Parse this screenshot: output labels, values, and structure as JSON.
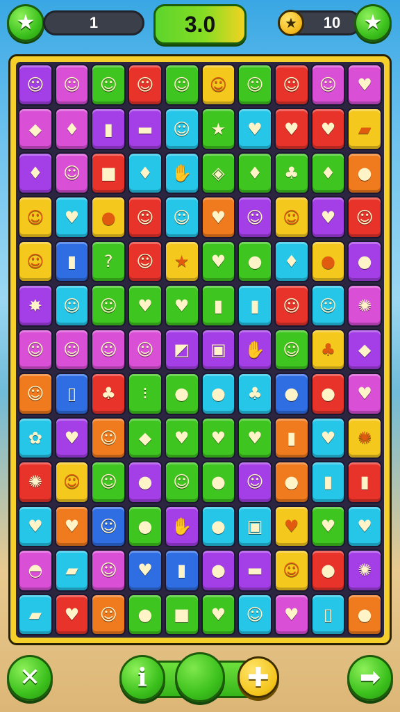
{
  "top_bar": {
    "level_value": "1",
    "score_value": "3.0",
    "coins_value": "10",
    "left_icon": "star-icon",
    "right_icon": "star-icon",
    "coin_icon": "star-coin-icon"
  },
  "bottom_bar": {
    "close_icon": "close-icon",
    "info_label": "i",
    "plus_icon": "plus-icon",
    "next_icon": "arrow-right-icon"
  },
  "colors": {
    "accent_green": "#3cc11d",
    "board_frame": "#f5d02a",
    "sky": "#39a7e4",
    "sand": "#dcb676"
  },
  "tile_palette": {
    "P": "#a43ee6",
    "O": "#f07a1e",
    "G": "#3fc51f",
    "R": "#e8332b",
    "Y": "#f5c81e",
    "C": "#25c6e8",
    "B": "#2f6de3",
    "M": "#d94fd6"
  },
  "board": {
    "rows": [
      [
        {
          "c": "P",
          "i": "☺"
        },
        {
          "c": "M",
          "i": "☺"
        },
        {
          "c": "G",
          "i": "☺"
        },
        {
          "c": "R",
          "i": "☺"
        },
        {
          "c": "G",
          "i": "☺"
        },
        {
          "c": "Y",
          "i": "☺"
        },
        {
          "c": "G",
          "i": "☺"
        },
        {
          "c": "R",
          "i": "☺"
        },
        {
          "c": "M",
          "i": "☺"
        },
        {
          "c": "M",
          "i": "♥"
        }
      ],
      [
        {
          "c": "M",
          "i": "◆"
        },
        {
          "c": "M",
          "i": "♦"
        },
        {
          "c": "P",
          "i": "▮"
        },
        {
          "c": "P",
          "i": "▬"
        },
        {
          "c": "C",
          "i": "☺"
        },
        {
          "c": "G",
          "i": "★"
        },
        {
          "c": "C",
          "i": "♥"
        },
        {
          "c": "R",
          "i": "♥"
        },
        {
          "c": "R",
          "i": "♥"
        },
        {
          "c": "Y",
          "i": "▰"
        }
      ],
      [
        {
          "c": "P",
          "i": "♦"
        },
        {
          "c": "M",
          "i": "☺"
        },
        {
          "c": "R",
          "i": "■"
        },
        {
          "c": "C",
          "i": "♦"
        },
        {
          "c": "C",
          "i": "✋"
        },
        {
          "c": "G",
          "i": "◈"
        },
        {
          "c": "G",
          "i": "♦"
        },
        {
          "c": "G",
          "i": "♣"
        },
        {
          "c": "G",
          "i": "♦"
        },
        {
          "c": "O",
          "i": "●"
        }
      ],
      [
        {
          "c": "Y",
          "i": "☺"
        },
        {
          "c": "C",
          "i": "♥"
        },
        {
          "c": "Y",
          "i": "●"
        },
        {
          "c": "R",
          "i": "☺"
        },
        {
          "c": "C",
          "i": "☺"
        },
        {
          "c": "O",
          "i": "♥"
        },
        {
          "c": "P",
          "i": "☺"
        },
        {
          "c": "Y",
          "i": "☺"
        },
        {
          "c": "P",
          "i": "♥"
        },
        {
          "c": "R",
          "i": "☺"
        }
      ],
      [
        {
          "c": "Y",
          "i": "☺"
        },
        {
          "c": "B",
          "i": "▮"
        },
        {
          "c": "G",
          "i": "?"
        },
        {
          "c": "R",
          "i": "☺"
        },
        {
          "c": "Y",
          "i": "★"
        },
        {
          "c": "G",
          "i": "♥"
        },
        {
          "c": "G",
          "i": "●"
        },
        {
          "c": "C",
          "i": "♦"
        },
        {
          "c": "Y",
          "i": "●"
        },
        {
          "c": "P",
          "i": "●"
        }
      ],
      [
        {
          "c": "P",
          "i": "✸"
        },
        {
          "c": "C",
          "i": "☺"
        },
        {
          "c": "G",
          "i": "☺"
        },
        {
          "c": "G",
          "i": "♥"
        },
        {
          "c": "G",
          "i": "♥"
        },
        {
          "c": "G",
          "i": "▮"
        },
        {
          "c": "C",
          "i": "▮"
        },
        {
          "c": "R",
          "i": "☺"
        },
        {
          "c": "C",
          "i": "☺"
        },
        {
          "c": "M",
          "i": "✺"
        }
      ],
      [
        {
          "c": "M",
          "i": "☺"
        },
        {
          "c": "M",
          "i": "☺"
        },
        {
          "c": "M",
          "i": "☺"
        },
        {
          "c": "M",
          "i": "☺"
        },
        {
          "c": "P",
          "i": "◩"
        },
        {
          "c": "P",
          "i": "▣"
        },
        {
          "c": "P",
          "i": "✋"
        },
        {
          "c": "G",
          "i": "☺"
        },
        {
          "c": "Y",
          "i": "♣"
        },
        {
          "c": "P",
          "i": "◆"
        }
      ],
      [
        {
          "c": "O",
          "i": "☺"
        },
        {
          "c": "B",
          "i": "▯"
        },
        {
          "c": "R",
          "i": "♣"
        },
        {
          "c": "G",
          "i": "⁝"
        },
        {
          "c": "G",
          "i": "●"
        },
        {
          "c": "C",
          "i": "●"
        },
        {
          "c": "C",
          "i": "♣"
        },
        {
          "c": "B",
          "i": "●"
        },
        {
          "c": "R",
          "i": "●"
        },
        {
          "c": "M",
          "i": "♥"
        }
      ],
      [
        {
          "c": "C",
          "i": "✿"
        },
        {
          "c": "P",
          "i": "♥"
        },
        {
          "c": "O",
          "i": "☺"
        },
        {
          "c": "G",
          "i": "◆"
        },
        {
          "c": "G",
          "i": "♥"
        },
        {
          "c": "G",
          "i": "♥"
        },
        {
          "c": "G",
          "i": "♥"
        },
        {
          "c": "O",
          "i": "▮"
        },
        {
          "c": "C",
          "i": "♥"
        },
        {
          "c": "Y",
          "i": "✺"
        }
      ],
      [
        {
          "c": "R",
          "i": "✺"
        },
        {
          "c": "Y",
          "i": "☺"
        },
        {
          "c": "G",
          "i": "☺"
        },
        {
          "c": "P",
          "i": "●"
        },
        {
          "c": "G",
          "i": "☺"
        },
        {
          "c": "G",
          "i": "●"
        },
        {
          "c": "P",
          "i": "☺"
        },
        {
          "c": "O",
          "i": "●"
        },
        {
          "c": "C",
          "i": "▮"
        },
        {
          "c": "R",
          "i": "▮"
        }
      ],
      [
        {
          "c": "C",
          "i": "♥"
        },
        {
          "c": "O",
          "i": "♥"
        },
        {
          "c": "B",
          "i": "☺"
        },
        {
          "c": "G",
          "i": "●"
        },
        {
          "c": "P",
          "i": "✋"
        },
        {
          "c": "C",
          "i": "●"
        },
        {
          "c": "C",
          "i": "▣"
        },
        {
          "c": "Y",
          "i": "♥"
        },
        {
          "c": "G",
          "i": "♥"
        },
        {
          "c": "C",
          "i": "♥"
        }
      ],
      [
        {
          "c": "M",
          "i": "◓"
        },
        {
          "c": "C",
          "i": "▰"
        },
        {
          "c": "M",
          "i": "☺"
        },
        {
          "c": "B",
          "i": "♥"
        },
        {
          "c": "B",
          "i": "▮"
        },
        {
          "c": "P",
          "i": "●"
        },
        {
          "c": "P",
          "i": "▬"
        },
        {
          "c": "Y",
          "i": "☺"
        },
        {
          "c": "R",
          "i": "●"
        },
        {
          "c": "P",
          "i": "✺"
        }
      ],
      [
        {
          "c": "C",
          "i": "▰"
        },
        {
          "c": "R",
          "i": "♥"
        },
        {
          "c": "O",
          "i": "☺"
        },
        {
          "c": "G",
          "i": "●"
        },
        {
          "c": "G",
          "i": "■"
        },
        {
          "c": "G",
          "i": "♥"
        },
        {
          "c": "C",
          "i": "☺"
        },
        {
          "c": "M",
          "i": "♥"
        },
        {
          "c": "C",
          "i": "▯"
        },
        {
          "c": "O",
          "i": "●"
        }
      ]
    ]
  }
}
